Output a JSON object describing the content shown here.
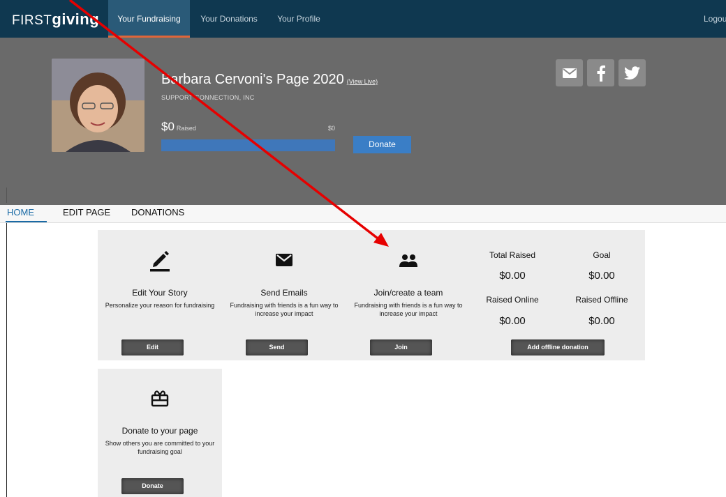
{
  "topnav": {
    "logo_first": "FIRST",
    "logo_giving": "giving",
    "tabs": [
      {
        "label": "Your Fundraising"
      },
      {
        "label": "Your Donations"
      },
      {
        "label": "Your Profile"
      }
    ],
    "logout_label": "Logou"
  },
  "header": {
    "page_title": "Barbara Cervoni's Page 2020",
    "view_live": "(View Live)",
    "org_name": "SUPPORT CONNECTION, INC",
    "raised_amount": "$0",
    "raised_label": "Raised",
    "goal_amount": "$0",
    "progress_fraction": 0,
    "donate_label": "Donate"
  },
  "subnav": {
    "tabs": [
      {
        "label": "HOME"
      },
      {
        "label": "EDIT PAGE"
      },
      {
        "label": "DONATIONS"
      }
    ]
  },
  "cards": {
    "edit_story": {
      "title": "Edit Your Story",
      "desc": "Personalize your reason for fundraising",
      "button": "Edit"
    },
    "send_emails": {
      "title": "Send Emails",
      "desc": "Fundraising with friends is a fun way to increase your impact",
      "button": "Send"
    },
    "team": {
      "title": "Join/create a team",
      "desc": "Fundraising with friends is a fun way to increase your impact",
      "button": "Join"
    },
    "donate_page": {
      "title": "Donate to your page",
      "desc": "Show others you are committed to your fundraising goal",
      "button": "Donate"
    }
  },
  "stats": {
    "total_raised_label": "Total Raised",
    "total_raised_value": "$0.00",
    "goal_label": "Goal",
    "goal_value": "$0.00",
    "raised_online_label": "Raised Online",
    "raised_online_value": "$0.00",
    "raised_offline_label": "Raised Offline",
    "raised_offline_value": "$0.00",
    "offline_button": "Add offline donation"
  },
  "colors": {
    "nav_bg": "#0f3850",
    "header_bg": "#6a6a6a",
    "accent_blue": "#3a7ec6",
    "annotation_arrow": "#e60000"
  }
}
